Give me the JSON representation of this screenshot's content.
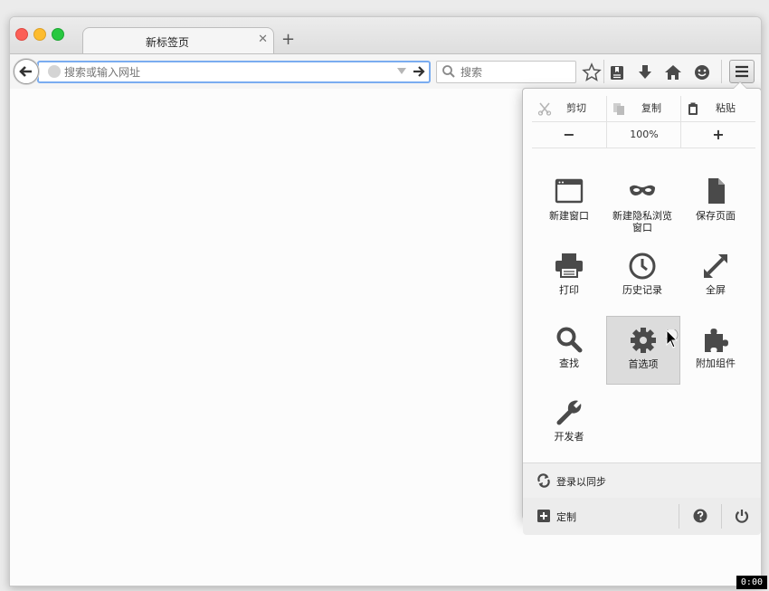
{
  "tab": {
    "title": "新标签页",
    "close": "✕",
    "new_tab": "+"
  },
  "urlbar": {
    "placeholder": "搜索或输入网址",
    "value": ""
  },
  "searchbar": {
    "placeholder": "搜索",
    "value": ""
  },
  "menu": {
    "edit": {
      "cut": "剪切",
      "copy": "复制",
      "paste": "粘贴"
    },
    "zoom": {
      "minus": "−",
      "level": "100%",
      "plus": "+"
    },
    "items": [
      {
        "label": "新建窗口",
        "icon": "window-icon"
      },
      {
        "label": "新建隐私浏览窗口",
        "icon": "mask-icon"
      },
      {
        "label": "保存页面",
        "icon": "page-icon"
      },
      {
        "label": "打印",
        "icon": "printer-icon"
      },
      {
        "label": "历史记录",
        "icon": "clock-icon"
      },
      {
        "label": "全屏",
        "icon": "fullscreen-icon"
      },
      {
        "label": "查找",
        "icon": "search-icon"
      },
      {
        "label": "首选项",
        "icon": "gear-icon"
      },
      {
        "label": "附加组件",
        "icon": "puzzle-icon"
      },
      {
        "label": "开发者",
        "icon": "wrench-icon"
      }
    ],
    "sync": {
      "label": "登录以同步"
    },
    "footer": {
      "customize": "定制"
    }
  },
  "timestamp": "0:00",
  "colors": {
    "accent": "#7aacf0",
    "icon": "#4a4a4a",
    "highlight": "#dcdcdc"
  }
}
